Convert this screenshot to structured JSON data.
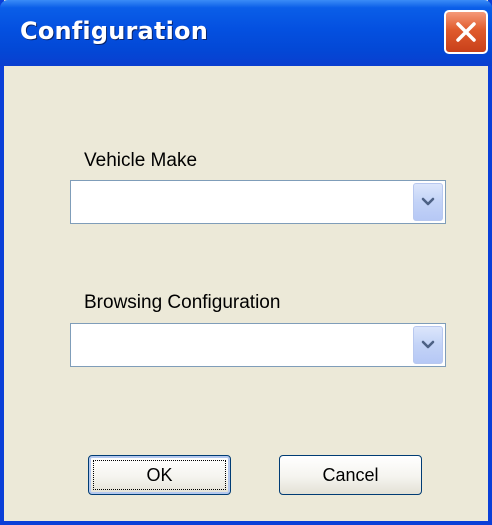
{
  "window": {
    "title": "Configuration"
  },
  "icons": {
    "close": "close-icon",
    "dropdown": "chevron-down-icon"
  },
  "fields": {
    "vehicle_make": {
      "label": "Vehicle Make",
      "value": ""
    },
    "browsing_configuration": {
      "label": "Browsing Configuration",
      "value": ""
    }
  },
  "buttons": {
    "ok_label": "OK",
    "cancel_label": "Cancel"
  },
  "colors": {
    "titlebar": "#0450e0",
    "window_bg": "#ece9d8",
    "close_button": "#e05a2c"
  }
}
